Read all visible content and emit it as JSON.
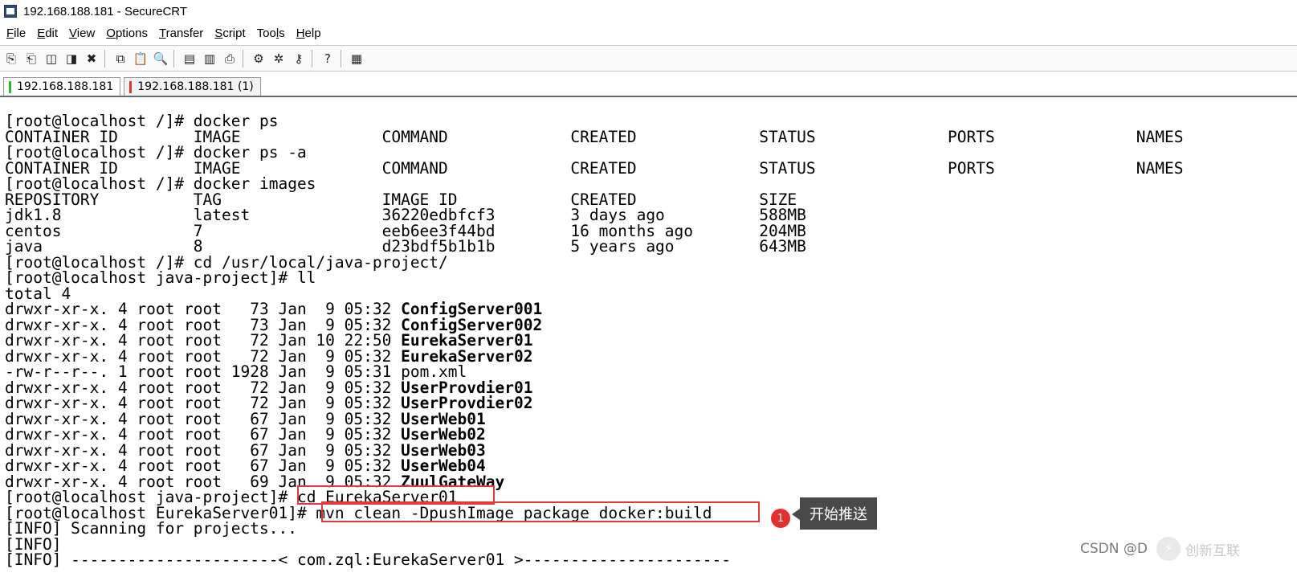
{
  "window": {
    "title": "192.168.188.181 - SecureCRT"
  },
  "menu": [
    {
      "u": "F",
      "rest": "ile"
    },
    {
      "u": "E",
      "rest": "dit"
    },
    {
      "u": "V",
      "rest": "iew"
    },
    {
      "u": "O",
      "rest": "ptions"
    },
    {
      "u": "T",
      "rest": "ransfer"
    },
    {
      "u": "S",
      "rest": "cript"
    },
    {
      "u": "",
      "rest": "Too",
      "u2": "l",
      "rest2": "s"
    },
    {
      "u": "H",
      "rest": "elp"
    }
  ],
  "toolbar": {
    "icons": [
      "⎘",
      "⎗",
      "◫",
      "◨",
      "✖",
      "|",
      "⧉",
      "📋",
      "🔍",
      "|",
      "▤",
      "▥",
      "⎙",
      "|",
      "⚙",
      "✲",
      "⚷",
      "|",
      "?",
      "|",
      "▦"
    ]
  },
  "tabs": [
    {
      "label": "192.168.188.181",
      "color": "#2fb52f"
    },
    {
      "label": "192.168.188.181 (1)",
      "color": "#e03030"
    }
  ],
  "terminal": {
    "lines": [
      "[root@localhost /]# docker ps",
      "CONTAINER ID        IMAGE               COMMAND             CREATED             STATUS              PORTS               NAMES",
      "[root@localhost /]# docker ps -a",
      "CONTAINER ID        IMAGE               COMMAND             CREATED             STATUS              PORTS               NAMES",
      "[root@localhost /]# docker images",
      "REPOSITORY          TAG                 IMAGE ID            CREATED             SIZE",
      "jdk1.8              latest              36220edbfcf3        3 days ago          588MB",
      "centos              7                   eeb6ee3f44bd        16 months ago       204MB",
      "java                8                   d23bdf5b1b1b        5 years ago         643MB",
      "[root@localhost /]# cd /usr/local/java-project/",
      "[root@localhost java-project]# ll",
      "total 4"
    ],
    "listing": [
      {
        "prefix": "drwxr-xr-x. 4 root root   73 Jan  9 05:32 ",
        "name": "ConfigServer001",
        "bold": true
      },
      {
        "prefix": "drwxr-xr-x. 4 root root   73 Jan  9 05:32 ",
        "name": "ConfigServer002",
        "bold": true
      },
      {
        "prefix": "drwxr-xr-x. 4 root root   72 Jan 10 22:50 ",
        "name": "EurekaServer01",
        "bold": true
      },
      {
        "prefix": "drwxr-xr-x. 4 root root   72 Jan  9 05:32 ",
        "name": "EurekaServer02",
        "bold": true
      },
      {
        "prefix": "-rw-r--r--. 1 root root 1928 Jan  9 05:31 ",
        "name": "pom.xml",
        "bold": false
      },
      {
        "prefix": "drwxr-xr-x. 4 root root   72 Jan  9 05:32 ",
        "name": "UserProvdier01",
        "bold": true
      },
      {
        "prefix": "drwxr-xr-x. 4 root root   72 Jan  9 05:32 ",
        "name": "UserProvdier02",
        "bold": true
      },
      {
        "prefix": "drwxr-xr-x. 4 root root   67 Jan  9 05:32 ",
        "name": "UserWeb01",
        "bold": true
      },
      {
        "prefix": "drwxr-xr-x. 4 root root   67 Jan  9 05:32 ",
        "name": "UserWeb02",
        "bold": true
      },
      {
        "prefix": "drwxr-xr-x. 4 root root   67 Jan  9 05:32 ",
        "name": "UserWeb03",
        "bold": true
      },
      {
        "prefix": "drwxr-xr-x. 4 root root   67 Jan  9 05:32 ",
        "name": "UserWeb04",
        "bold": true
      },
      {
        "prefix": "drwxr-xr-x. 4 root root   69 Jan  9 05:32 ",
        "name": "ZuulGateWay",
        "bold": true
      }
    ],
    "tail": [
      {
        "prompt": "[root@localhost java-project]# ",
        "cmd": "cd EurekaServer01"
      },
      {
        "prompt": "[root@localhost EurekaServer01]# ",
        "cmd": "mvn clean -DpushImage package docker:build"
      },
      {
        "prompt": "",
        "cmd": "[INFO] Scanning for projects..."
      },
      {
        "prompt": "",
        "cmd": "[INFO]"
      },
      {
        "prompt": "",
        "cmd": "[INFO] ----------------------< com.zql:EurekaServer01 >----------------------"
      }
    ]
  },
  "annotation": {
    "badge": "1",
    "tooltip": "开始推送"
  },
  "watermark": {
    "text": "CSDN @D",
    "logo": "创新互联"
  }
}
